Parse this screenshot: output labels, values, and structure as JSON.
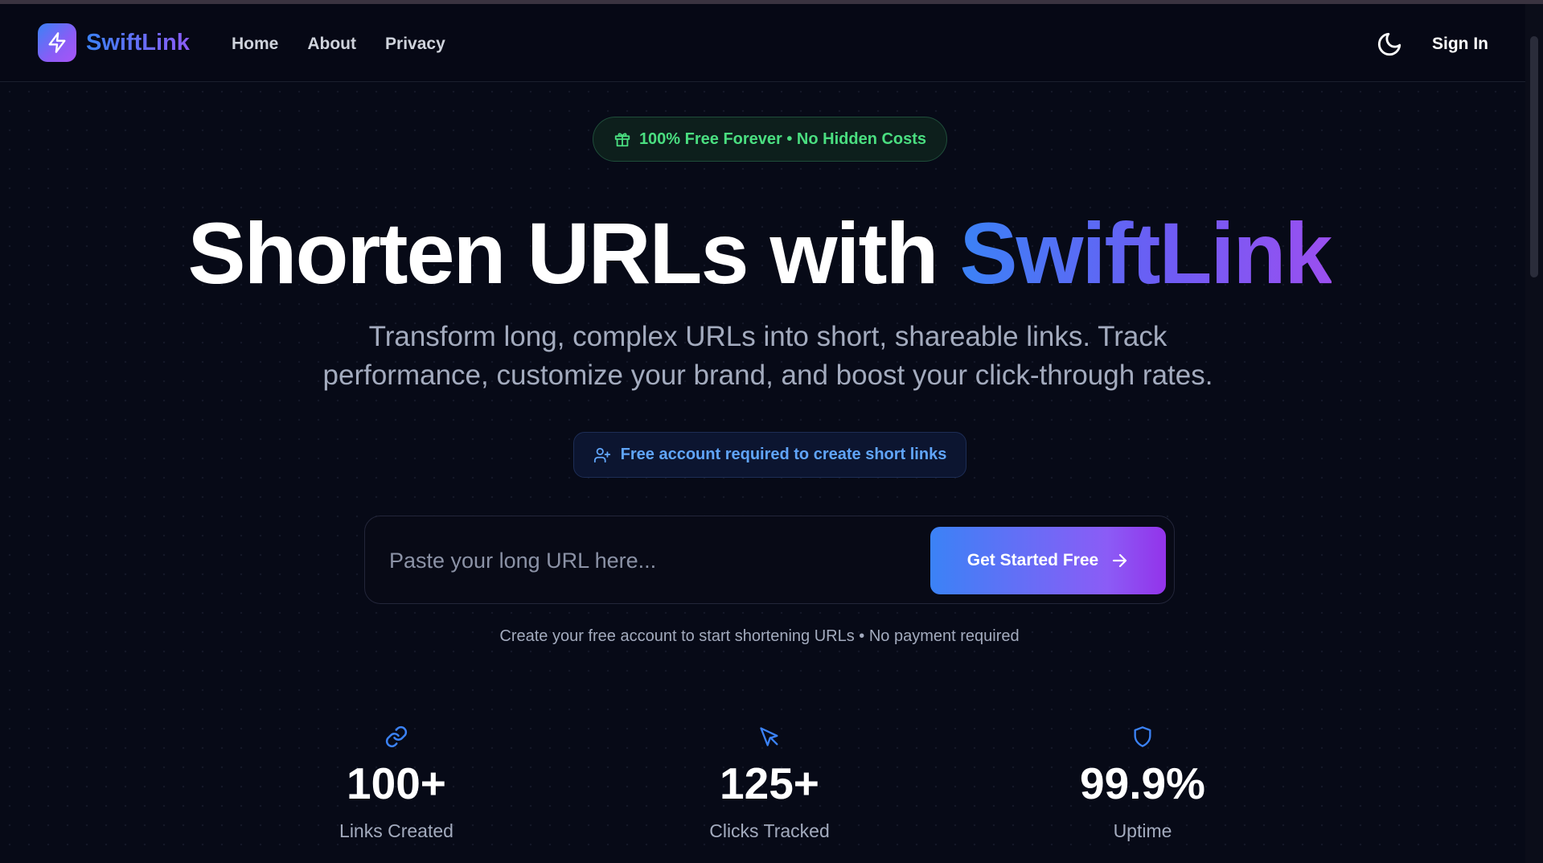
{
  "brand": {
    "name": "SwiftLink",
    "logo_icon": "lightning-bolt-icon"
  },
  "nav": {
    "links": [
      "Home",
      "About",
      "Privacy"
    ],
    "theme_icon": "moon-icon",
    "sign_in": "Sign In"
  },
  "hero": {
    "badge": "100% Free Forever • No Hidden Costs",
    "badge_icon": "gift-icon",
    "title_main": "Shorten URLs with ",
    "title_accent": "SwiftLink",
    "subtitle": "Transform long, complex URLs into short, shareable links. Track performance, customize your brand, and boost your click-through rates.",
    "notice": "Free account required to create short links",
    "notice_icon": "user-plus-icon"
  },
  "shortener": {
    "placeholder": "Paste your long URL here...",
    "value": "",
    "button": "Get Started Free",
    "button_icon": "arrow-right-icon",
    "helper": "Create your free account to start shortening URLs • No payment required"
  },
  "stats": [
    {
      "icon": "link-icon",
      "value": "100+",
      "label": "Links Created"
    },
    {
      "icon": "cursor-arrow-icon",
      "value": "125+",
      "label": "Clicks Tracked"
    },
    {
      "icon": "shield-icon",
      "value": "99.9%",
      "label": "Uptime"
    }
  ],
  "colors": {
    "background": "#060815",
    "accent_blue": "#3b82f6",
    "accent_purple": "#8b5cf6",
    "badge_green": "#4ade80",
    "notice_blue": "#60a5fa",
    "muted_text": "#a3abbe"
  }
}
